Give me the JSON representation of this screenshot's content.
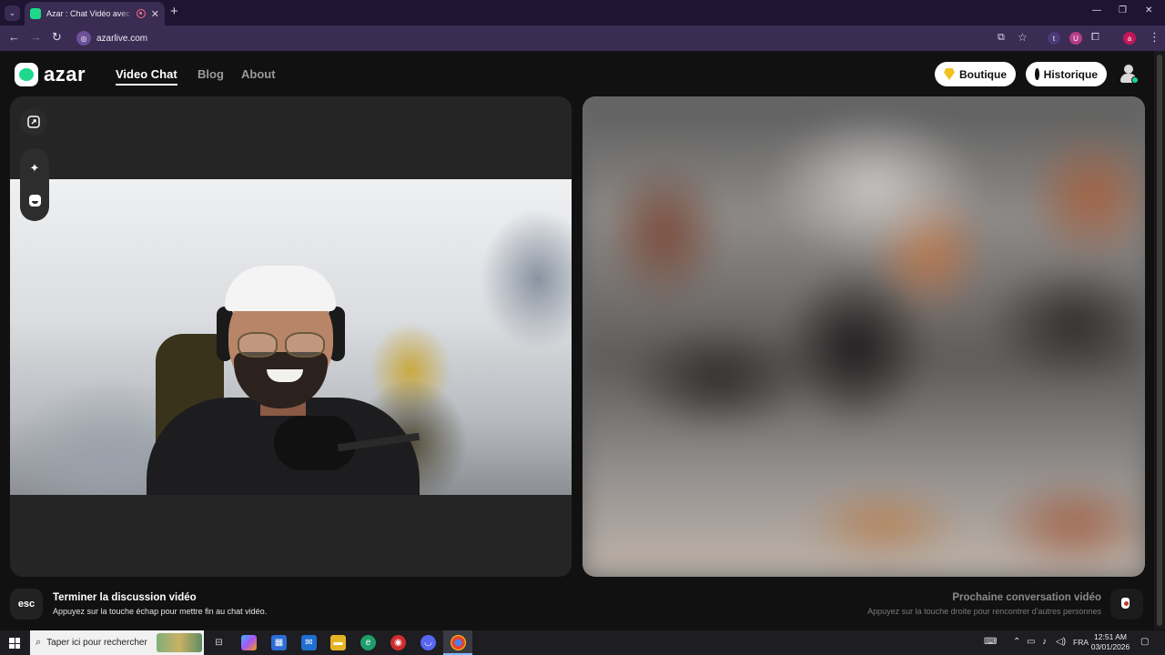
{
  "browser": {
    "tab_title": "Azar : Chat Vidéo avec de n",
    "url": "azarlive.com",
    "profile_initial": "a"
  },
  "header": {
    "logo_text": "azar",
    "nav": [
      "Video Chat",
      "Blog",
      "About"
    ],
    "boutique_label": "Boutique",
    "historique_label": "Historique"
  },
  "footer": {
    "esc_key": "esc",
    "end_title": "Terminer la discussion vidéo",
    "end_sub": "Appuyez sur la touche échap pour mettre fin au chat vidéo.",
    "next_title": "Prochaine conversation vidéo",
    "next_sub": "Appuyez sur la touche droite pour rencontrer d'autres personnes"
  },
  "taskbar": {
    "search_placeholder": "Taper ici pour rechercher",
    "language": "FRA",
    "time": "12:51 AM",
    "date": "03/01/2026"
  },
  "colors": {
    "brand_green": "#1ed98b",
    "background": "#111111",
    "browser_frame": "#3a2c52"
  }
}
